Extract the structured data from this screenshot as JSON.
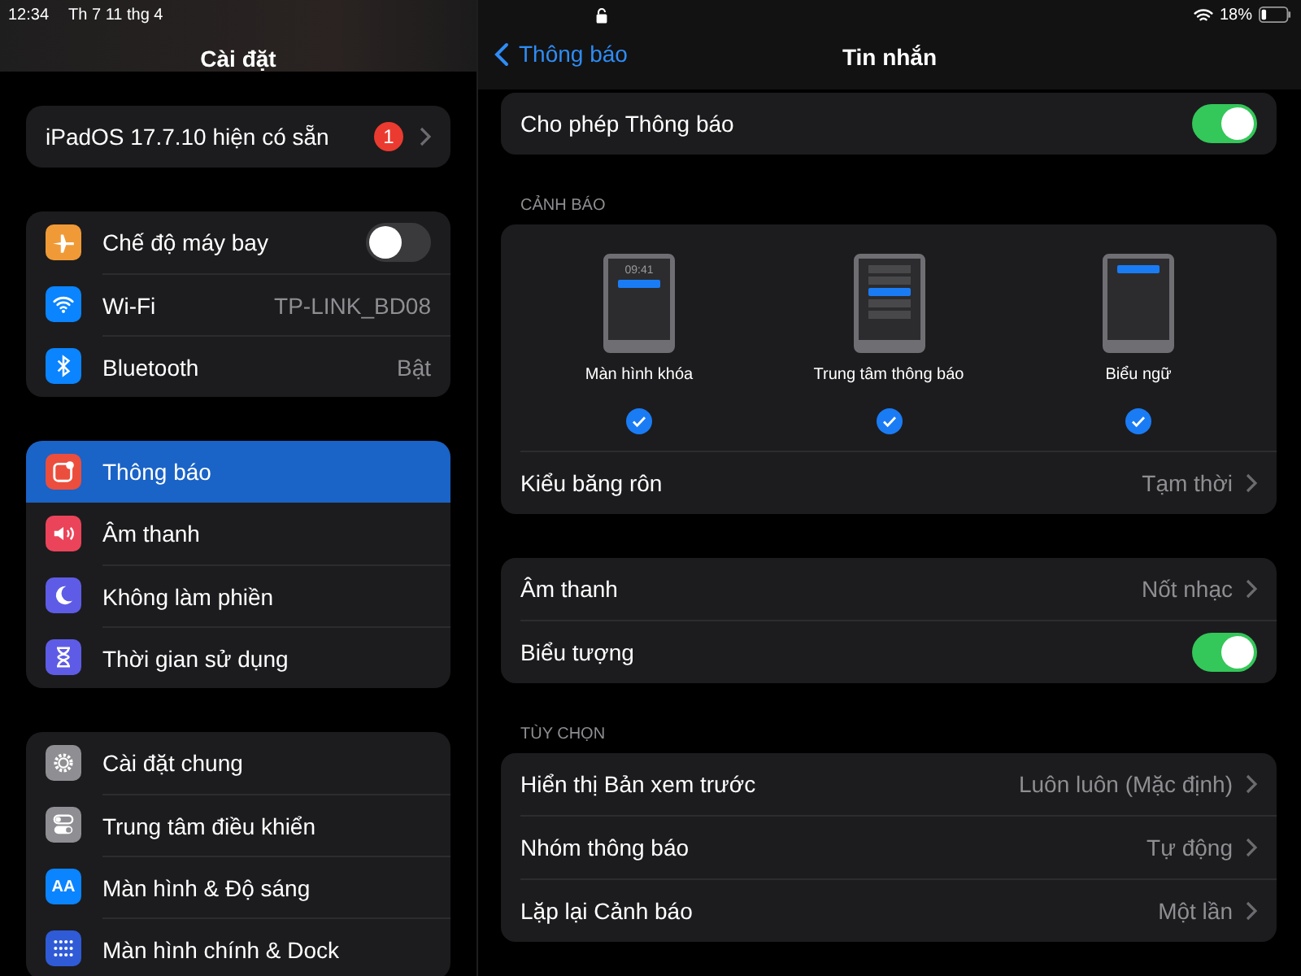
{
  "status_bar": {
    "time": "12:34",
    "date": "Th 7 11 thg 4",
    "battery": "18%"
  },
  "sidebar": {
    "title": "Cài đặt",
    "update": {
      "label": "iPadOS 17.7.10 hiện có sẵn",
      "badge": "1"
    },
    "groups": [
      {
        "items": [
          {
            "label": "Chế độ máy bay",
            "kind": "toggle",
            "on": false,
            "selected": false
          },
          {
            "label": "Wi-Fi",
            "kind": "value",
            "value": "TP-LINK_BD08",
            "selected": false
          },
          {
            "label": "Bluetooth",
            "kind": "value",
            "value": "Bật",
            "selected": false
          }
        ]
      },
      {
        "items": [
          {
            "label": "Thông báo",
            "kind": "link",
            "selected": true
          },
          {
            "label": "Âm thanh",
            "kind": "link",
            "selected": false
          },
          {
            "label": "Không làm phiền",
            "kind": "link",
            "selected": false
          },
          {
            "label": "Thời gian sử dụng",
            "kind": "link",
            "selected": false
          }
        ]
      },
      {
        "items": [
          {
            "label": "Cài đặt chung",
            "kind": "link",
            "selected": false
          },
          {
            "label": "Trung tâm điều khiển",
            "kind": "link",
            "selected": false
          },
          {
            "label": "Màn hình & Độ sáng",
            "kind": "link",
            "icon_text": "AA",
            "selected": false
          },
          {
            "label": "Màn hình chính & Dock",
            "kind": "link",
            "selected": false
          }
        ]
      }
    ]
  },
  "detail": {
    "back": "Thông báo",
    "title": "Tin nhắn",
    "allow": {
      "label": "Cho phép Thông báo",
      "on": true
    },
    "alerts_header": "CẢNH BÁO",
    "alerts": [
      {
        "label": "Màn hình khóa",
        "screen_time": "09:41",
        "checked": true
      },
      {
        "label": "Trung tâm thông báo",
        "checked": true
      },
      {
        "label": "Biểu ngữ",
        "checked": true
      }
    ],
    "banner_style": {
      "label": "Kiểu băng rôn",
      "value": "Tạm thời"
    },
    "sound_group": [
      {
        "label": "Âm thanh",
        "kind": "value",
        "value": "Nốt nhạc"
      },
      {
        "label": "Biểu tượng",
        "kind": "toggle",
        "on": true
      }
    ],
    "options_header": "TÙY CHỌN",
    "options": [
      {
        "label": "Hiển thị Bản xem trước",
        "value": "Luôn luôn (Mặc định)"
      },
      {
        "label": "Nhóm thông báo",
        "value": "Tự động"
      },
      {
        "label": "Lặp lại Cảnh báo",
        "value": "Một lần"
      }
    ]
  }
}
